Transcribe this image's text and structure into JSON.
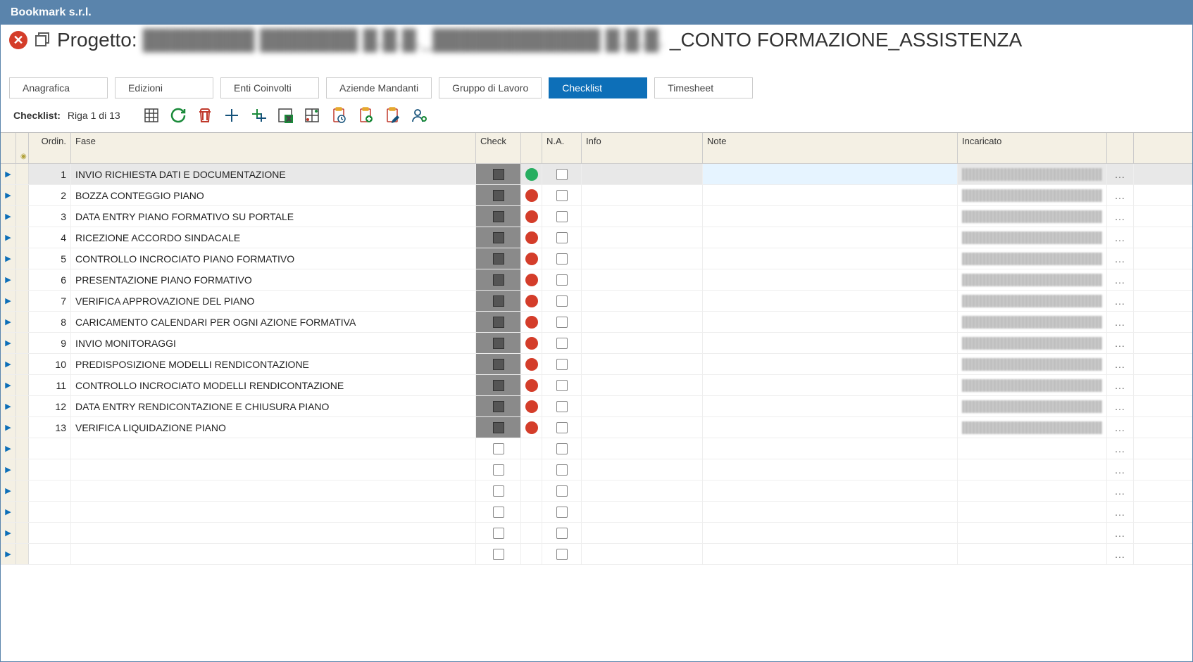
{
  "titlebar": "Bookmark s.r.l.",
  "header": {
    "title_prefix": "Progetto:",
    "title_redacted": "████████ ███████ █.█.█._████████████ █.█.█.",
    "title_suffix": "_CONTO FORMAZIONE_ASSISTENZA"
  },
  "tabs": [
    {
      "label": "Anagrafica",
      "active": false
    },
    {
      "label": "Edizioni",
      "active": false
    },
    {
      "label": "Enti Coinvolti",
      "active": false
    },
    {
      "label": "Aziende Mandanti",
      "active": false
    },
    {
      "label": "Gruppo di Lavoro",
      "active": false
    },
    {
      "label": "Checklist",
      "active": true
    },
    {
      "label": "Timesheet",
      "active": false
    }
  ],
  "toolbar": {
    "label": "Checklist:",
    "riga_info": "Riga 1 di 13"
  },
  "columns": {
    "ordin": "Ordin.",
    "fase": "Fase",
    "check": "Check",
    "na": "N.A.",
    "info": "Info",
    "note": "Note",
    "incaricato": "Incaricato"
  },
  "rows": [
    {
      "ordin": 1,
      "fase": "INVIO RICHIESTA DATI E DOCUMENTAZIONE",
      "status": "green",
      "selected": true
    },
    {
      "ordin": 2,
      "fase": "BOZZA CONTEGGIO PIANO",
      "status": "red"
    },
    {
      "ordin": 3,
      "fase": "DATA ENTRY PIANO FORMATIVO SU PORTALE",
      "status": "red"
    },
    {
      "ordin": 4,
      "fase": "RICEZIONE ACCORDO SINDACALE",
      "status": "red"
    },
    {
      "ordin": 5,
      "fase": "CONTROLLO INCROCIATO PIANO FORMATIVO",
      "status": "red"
    },
    {
      "ordin": 6,
      "fase": "PRESENTAZIONE PIANO FORMATIVO",
      "status": "red"
    },
    {
      "ordin": 7,
      "fase": "VERIFICA APPROVAZIONE DEL PIANO",
      "status": "red"
    },
    {
      "ordin": 8,
      "fase": "CARICAMENTO CALENDARI PER OGNI AZIONE FORMATIVA",
      "status": "red"
    },
    {
      "ordin": 9,
      "fase": "INVIO MONITORAGGI",
      "status": "red"
    },
    {
      "ordin": 10,
      "fase": "PREDISPOSIZIONE MODELLI RENDICONTAZIONE",
      "status": "red"
    },
    {
      "ordin": 11,
      "fase": "CONTROLLO INCROCIATO MODELLI RENDICONTAZIONE",
      "status": "red"
    },
    {
      "ordin": 12,
      "fase": "DATA ENTRY RENDICONTAZIONE E CHIUSURA PIANO",
      "status": "red"
    },
    {
      "ordin": 13,
      "fase": "VERIFICA LIQUIDAZIONE PIANO",
      "status": "red"
    }
  ],
  "empty_row_count": 6,
  "row_menu": "..."
}
